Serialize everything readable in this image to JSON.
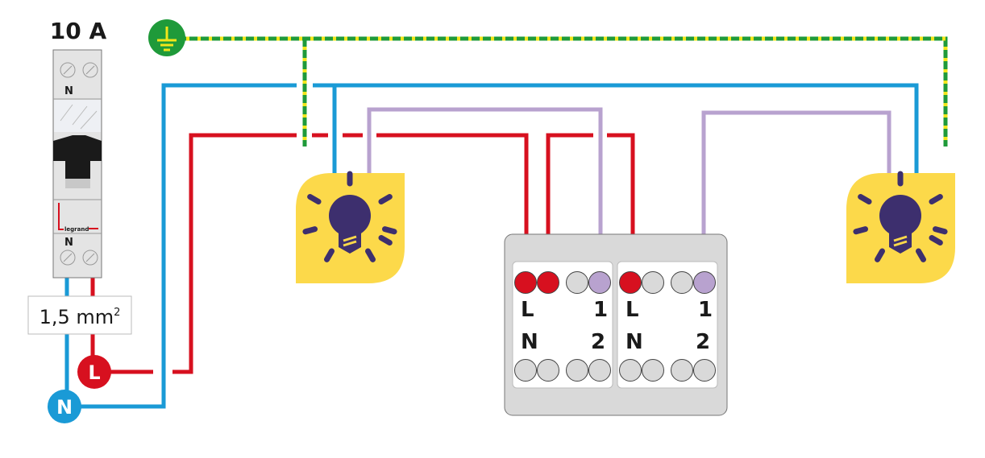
{
  "breaker": {
    "rating": "10 A",
    "top_terminal_label": "N",
    "bottom_terminal_label": "N",
    "brand": "legrand"
  },
  "cable": {
    "section": "1,5 mm",
    "section_sup": "2"
  },
  "sources": {
    "line": "L",
    "neutral": "N"
  },
  "switch_box": {
    "modules": [
      {
        "top_left": "L",
        "top_right": "1",
        "bottom_left": "N",
        "bottom_right": "2"
      },
      {
        "top_left": "L",
        "top_right": "1",
        "bottom_left": "N",
        "bottom_right": "2"
      }
    ]
  },
  "colors": {
    "earth_green": "#1f9a3a",
    "earth_yellow": "#f2e61a",
    "neutral": "#1a9ad6",
    "line": "#d7101f",
    "switched": "#b8a2cf",
    "lamp": "#fcd94a",
    "bulb": "#3d2f6e",
    "box": "#d9d9d9"
  },
  "icons": {
    "earth": "earth-ground-icon",
    "lamp": "light-bulb-icon"
  }
}
